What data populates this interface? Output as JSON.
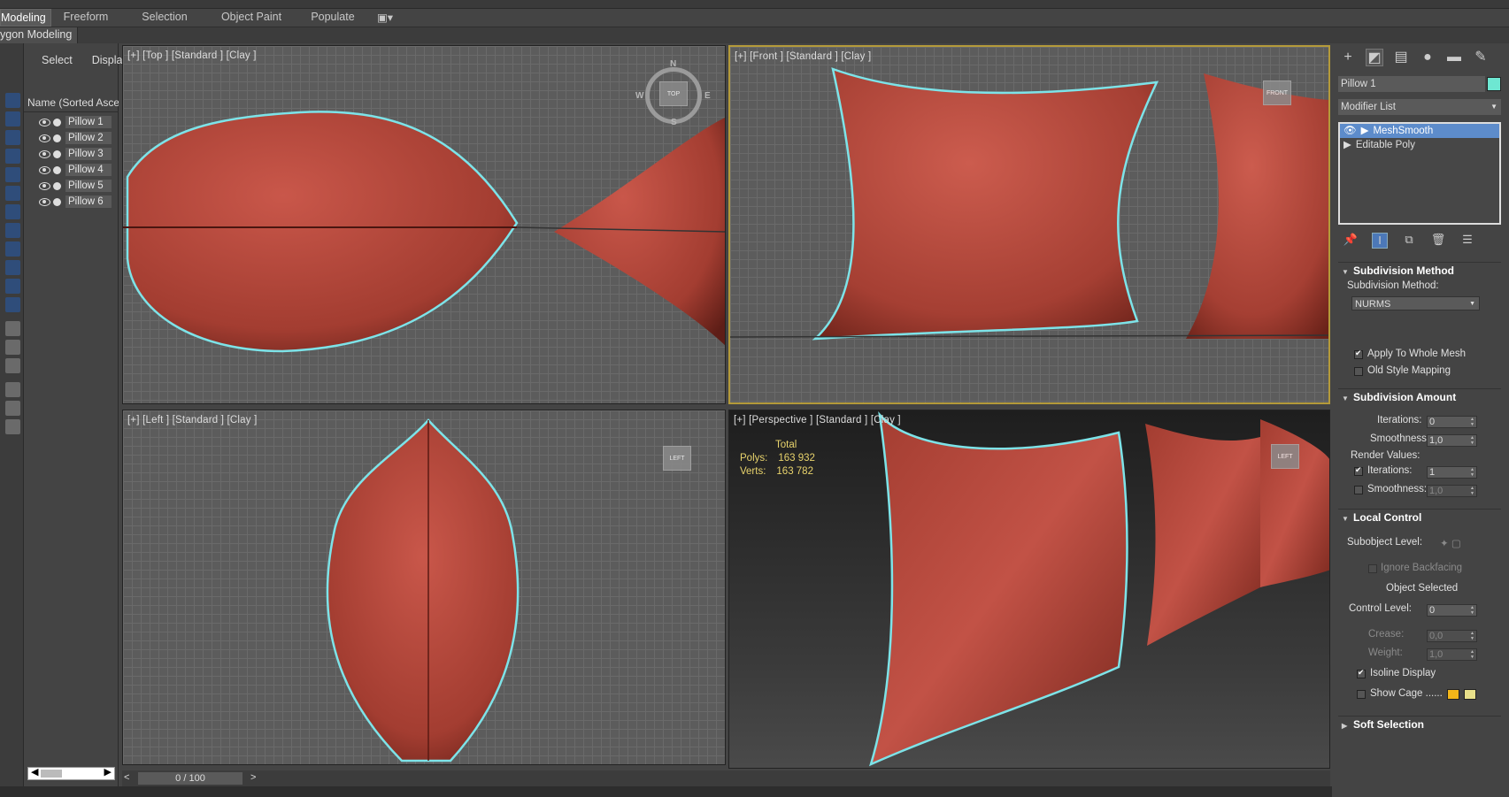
{
  "ribbon": {
    "tabs": [
      "Modeling",
      "Freeform",
      "Selection",
      "Object Paint",
      "Populate"
    ],
    "sub": "ygon Modeling"
  },
  "explorer": {
    "menu": [
      "Select",
      "Display"
    ],
    "header": "Name (Sorted Ascen",
    "items": [
      "Pillow 1",
      "Pillow 2",
      "Pillow 3",
      "Pillow 4",
      "Pillow 5",
      "Pillow 6"
    ]
  },
  "viewports": {
    "top": "[+] [Top ] [Standard ] [Clay ]",
    "front": "[+] [Front ] [Standard ] [Clay ]",
    "left": "[+] [Left ] [Standard ] [Clay ]",
    "perspective": "[+] [Perspective ] [Standard ] [Clay ]"
  },
  "stats": {
    "total": "Total",
    "polys_label": "Polys:",
    "polys": "163 932",
    "verts_label": "Verts:",
    "verts": "163 782"
  },
  "viewcube": {
    "top": "TOP",
    "front": "FRONT",
    "left": "LEFT",
    "persp": "LEFT",
    "compass": {
      "n": "N",
      "s": "S",
      "e": "E",
      "w": "W"
    }
  },
  "timeline": {
    "frame": "0 / 100",
    "prev": "<",
    "next": ">"
  },
  "command_panel": {
    "object_name": "Pillow 1",
    "object_color": "#6ee7d2",
    "modifier_list": "Modifier List",
    "stack": [
      "MeshSmooth",
      "Editable Poly"
    ],
    "rollouts": {
      "subdivision_method": {
        "title": "Subdivision Method",
        "method_label": "Subdivision Method:",
        "method_value": "NURMS",
        "apply_whole": "Apply To Whole Mesh",
        "old_style": "Old Style Mapping"
      },
      "subdivision_amount": {
        "title": "Subdivision Amount",
        "iterations_label": "Iterations:",
        "iterations": "0",
        "smoothness_label": "Smoothness:",
        "smoothness": "1,0",
        "render_values": "Render Values:",
        "r_iterations_label": "Iterations:",
        "r_iterations": "1",
        "r_smoothness_label": "Smoothness:",
        "r_smoothness": "1,0"
      },
      "local_control": {
        "title": "Local Control",
        "subobject_label": "Subobject Level:",
        "ignore_backfacing": "Ignore Backfacing",
        "object_selected": "Object Selected",
        "control_level_label": "Control Level:",
        "control_level": "0",
        "crease_label": "Crease:",
        "crease": "0,0",
        "weight_label": "Weight:",
        "weight": "1,0",
        "isoline": "Isoline Display",
        "show_cage": "Show Cage ......",
        "cage_color_1": "#f2b619",
        "cage_color_2": "#e8e08a"
      },
      "soft_selection": {
        "title": "Soft Selection"
      }
    }
  },
  "colors": {
    "pillow": "#b5473a",
    "outline": "#7de3e8",
    "stats": "#e8d36c",
    "active_border": "#b49a3a"
  }
}
